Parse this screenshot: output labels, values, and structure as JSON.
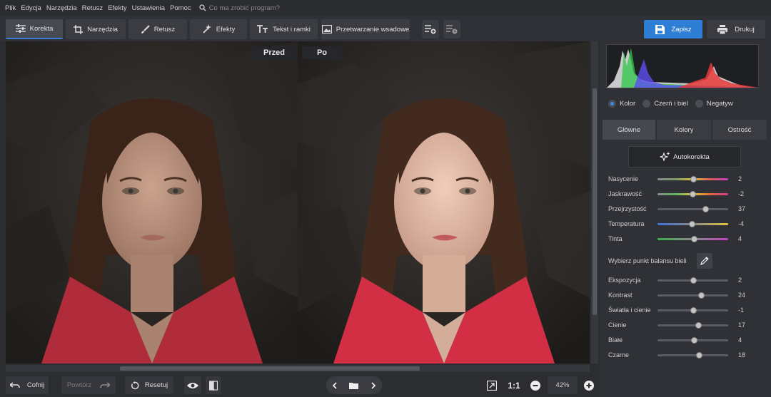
{
  "menu": {
    "items": [
      "Plik",
      "Edycja",
      "Narzędzia",
      "Retusz",
      "Efekty",
      "Ustawienia",
      "Pomoc"
    ],
    "search_placeholder": "Co ma zrobić program?"
  },
  "toolbar": {
    "tabs": [
      {
        "label": "Korekta",
        "active": true
      },
      {
        "label": "Narzędzia"
      },
      {
        "label": "Retusz"
      },
      {
        "label": "Efekty"
      },
      {
        "label": "Tekst i ramki"
      },
      {
        "label": "Przetwarzanie wsadowe"
      }
    ],
    "save_label": "Zapisz",
    "print_label": "Drukuj"
  },
  "canvas": {
    "before_label": "Przed",
    "after_label": "Po"
  },
  "bottombar": {
    "undo_label": "Cofnij",
    "redo_label": "Powtórz",
    "reset_label": "Resetuj",
    "one_to_one": "1:1",
    "zoom": "42%"
  },
  "panel": {
    "color_modes": [
      {
        "label": "Kolor",
        "selected": true
      },
      {
        "label": "Czerń i biel"
      },
      {
        "label": "Negatyw"
      }
    ],
    "tabs": [
      {
        "label": "Główne",
        "active": true
      },
      {
        "label": "Kolory"
      },
      {
        "label": "Ostrość"
      }
    ],
    "autokorekta_label": "Autokorekta",
    "white_balance_label": "Wybierz punkt balansu bieli",
    "sliders_top": [
      {
        "label": "Nasycenie",
        "value": "2",
        "pos": 0.51,
        "gradient": "saturation"
      },
      {
        "label": "Jaskrawość",
        "value": "-2",
        "pos": 0.49,
        "gradient": "vibrance"
      },
      {
        "label": "Przejrzystość",
        "value": "37",
        "pos": 0.68,
        "gradient": "none"
      },
      {
        "label": "Temperatura",
        "value": "-4",
        "pos": 0.48,
        "gradient": "temperature"
      },
      {
        "label": "Tinta",
        "value": "4",
        "pos": 0.52,
        "gradient": "tint"
      }
    ],
    "sliders_bottom": [
      {
        "label": "Ekspozycja",
        "value": "2",
        "pos": 0.51
      },
      {
        "label": "Kontrast",
        "value": "24",
        "pos": 0.62
      },
      {
        "label": "Światła i cienie",
        "value": "-1",
        "pos": 0.5
      },
      {
        "label": "Cienie",
        "value": "17",
        "pos": 0.58
      },
      {
        "label": "Białe",
        "value": "4",
        "pos": 0.52
      },
      {
        "label": "Czarne",
        "value": "18",
        "pos": 0.59
      }
    ]
  }
}
